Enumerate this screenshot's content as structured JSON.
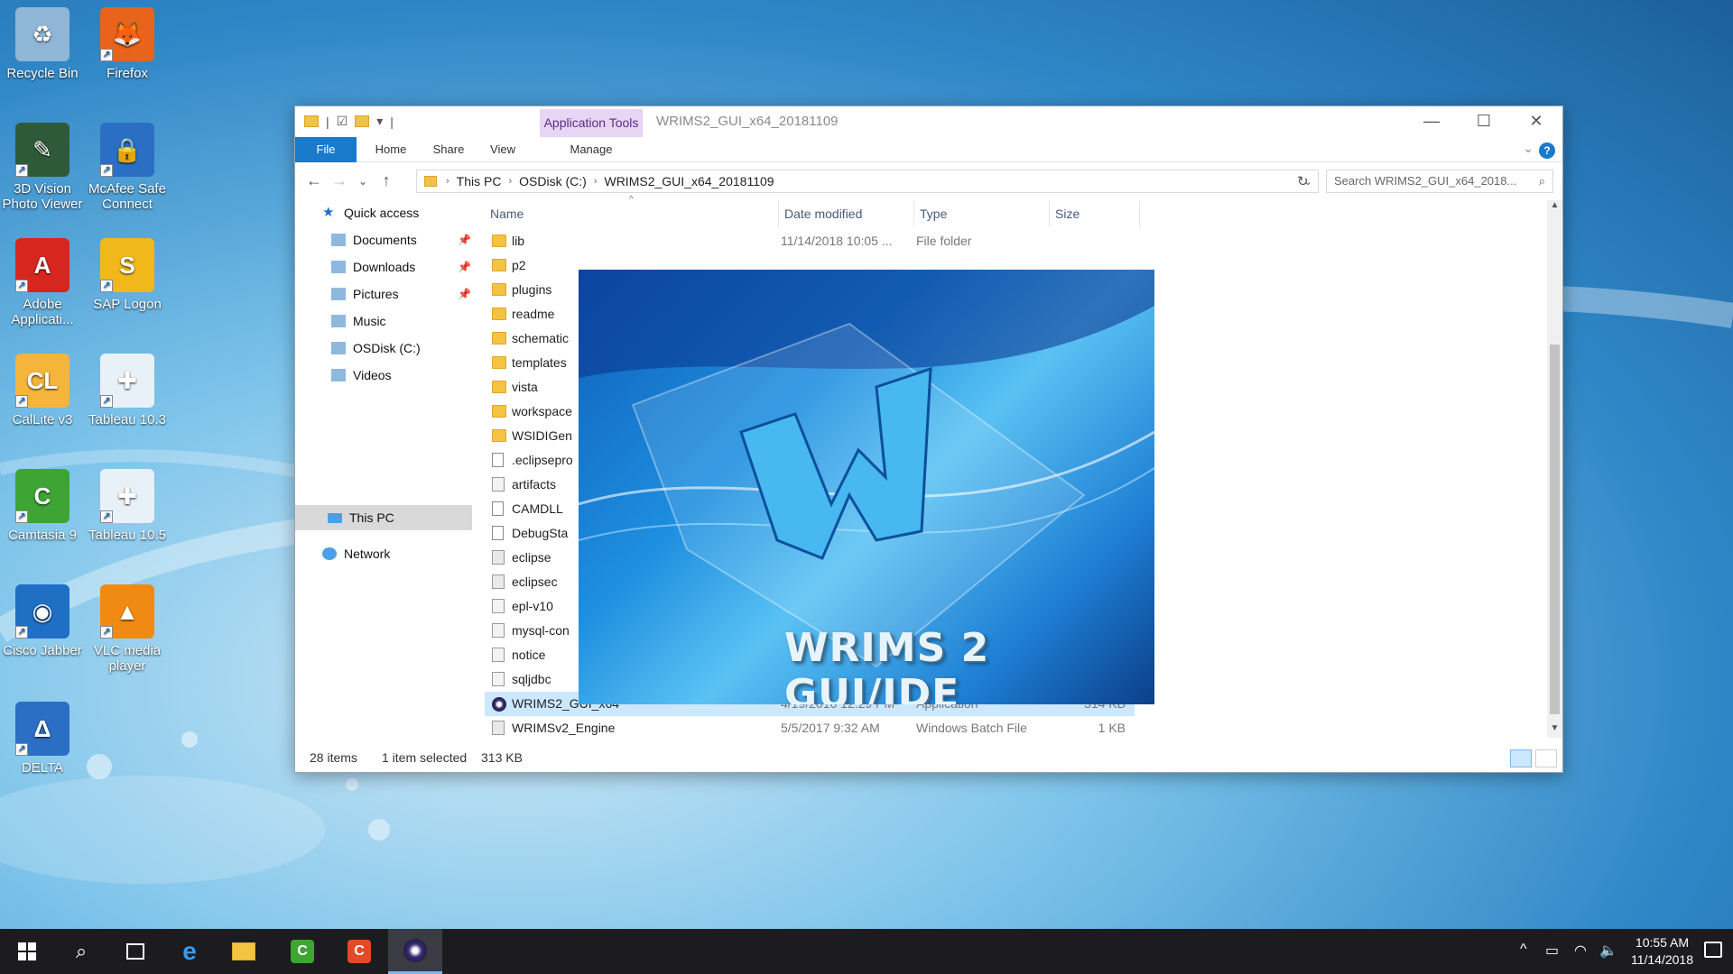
{
  "desktop": {
    "icons": [
      {
        "label": "Recycle Bin",
        "glyph": "♻",
        "color": "#8fb6d6"
      },
      {
        "label": "Firefox",
        "glyph": "🦊",
        "color": "#e8631c"
      },
      {
        "label": "3D Vision Photo Viewer",
        "glyph": "✎",
        "color": "#2f5a3a"
      },
      {
        "label": "McAfee Safe Connect",
        "glyph": "🔒",
        "color": "#2b6fc4"
      },
      {
        "label": "Adobe Applicati...",
        "glyph": "A",
        "color": "#d7261e"
      },
      {
        "label": "SAP Logon",
        "glyph": "S",
        "color": "#f1b81c"
      },
      {
        "label": "CalLite v3",
        "glyph": "CL",
        "color": "#f5b53a"
      },
      {
        "label": "Tableau 10.3",
        "glyph": "✚",
        "color": "#e9f1f8"
      },
      {
        "label": "Camtasia 9",
        "glyph": "C",
        "color": "#3ea534"
      },
      {
        "label": "Tableau 10.5",
        "glyph": "✚",
        "color": "#e9f1f8"
      },
      {
        "label": "Cisco Jabber",
        "glyph": "◉",
        "color": "#1f6fc5"
      },
      {
        "label": "VLC media player",
        "glyph": "▲",
        "color": "#f08a12"
      },
      {
        "label": "DELTA",
        "glyph": "Δ",
        "color": "#2a6fc4"
      }
    ]
  },
  "window": {
    "title": "WRIMS2_GUI_x64_20181109",
    "context_tab": "Application Tools",
    "ribbon_tabs": [
      "File",
      "Home",
      "Share",
      "View",
      "Manage"
    ],
    "controls": {
      "minimize": "—",
      "maximize": "☐",
      "close": "✕"
    }
  },
  "address": {
    "crumbs": [
      "This PC",
      "OSDisk (C:)",
      "WRIMS2_GUI_x64_20181109"
    ],
    "search_placeholder": "Search WRIMS2_GUI_x64_2018..."
  },
  "nav": {
    "quick_access": "Quick access",
    "items": [
      {
        "label": "Documents",
        "pinned": true
      },
      {
        "label": "Downloads",
        "pinned": true
      },
      {
        "label": "Pictures",
        "pinned": true
      },
      {
        "label": "Music",
        "pinned": false
      },
      {
        "label": "OSDisk (C:)",
        "pinned": false
      },
      {
        "label": "Videos",
        "pinned": false
      }
    ],
    "this_pc": "This PC",
    "network": "Network"
  },
  "columns": {
    "name": "Name",
    "date": "Date modified",
    "type": "Type",
    "size": "Size"
  },
  "files": [
    {
      "name": "lib",
      "date": "11/14/2018 10:05 ...",
      "type": "File folder",
      "size": "",
      "icon": "folder"
    },
    {
      "name": "p2",
      "date": "",
      "type": "",
      "size": "",
      "icon": "folder"
    },
    {
      "name": "plugins",
      "date": "",
      "type": "",
      "size": "",
      "icon": "folder"
    },
    {
      "name": "readme",
      "date": "",
      "type": "",
      "size": "",
      "icon": "folder"
    },
    {
      "name": "schematic",
      "date": "",
      "type": "",
      "size": "",
      "icon": "folder"
    },
    {
      "name": "templates",
      "date": "",
      "type": "",
      "size": "",
      "icon": "folder"
    },
    {
      "name": "vista",
      "date": "",
      "type": "",
      "size": "",
      "icon": "folder"
    },
    {
      "name": "workspace",
      "date": "",
      "type": "",
      "size": "",
      "icon": "folder"
    },
    {
      "name": "WSIDIGen",
      "date": "",
      "type": "",
      "size": "",
      "icon": "folder"
    },
    {
      "name": ".eclipsepro",
      "date": "",
      "type": "",
      "size": "",
      "icon": "file"
    },
    {
      "name": "artifacts",
      "date": "",
      "type": "",
      "size": "",
      "icon": "jar"
    },
    {
      "name": "CAMDLL",
      "date": "",
      "type": "",
      "size": "",
      "icon": "file"
    },
    {
      "name": "DebugSta",
      "date": "",
      "type": "",
      "size": "",
      "icon": "file"
    },
    {
      "name": "eclipse",
      "date": "",
      "type": "",
      "size": "",
      "icon": "gear"
    },
    {
      "name": "eclipsec",
      "date": "",
      "type": "",
      "size": "",
      "icon": "gear"
    },
    {
      "name": "epl-v10",
      "date": "",
      "type": "",
      "size": "",
      "icon": "jar"
    },
    {
      "name": "mysql-con",
      "date": "",
      "type": "",
      "size": "",
      "icon": "jar"
    },
    {
      "name": "notice",
      "date": "",
      "type": "",
      "size": "",
      "icon": "jar"
    },
    {
      "name": "sqljdbc",
      "date": "",
      "type": "",
      "size": "",
      "icon": "jar"
    },
    {
      "name": "WRIMS2_GUI_x64",
      "date": "4/19/2016 12:29 PM",
      "type": "Application",
      "size": "314 KB",
      "icon": "app",
      "selected": true
    },
    {
      "name": "WRIMSv2_Engine",
      "date": "5/5/2017 9:32 AM",
      "type": "Windows Batch File",
      "size": "1 KB",
      "icon": "gear"
    }
  ],
  "status": {
    "items": "28 items",
    "selected": "1 item selected",
    "size": "313 KB"
  },
  "splash": {
    "title": "WRIMS 2 GUI/IDE"
  },
  "taskbar": {
    "clock_time": "10:55 AM",
    "clock_date": "11/14/2018"
  }
}
